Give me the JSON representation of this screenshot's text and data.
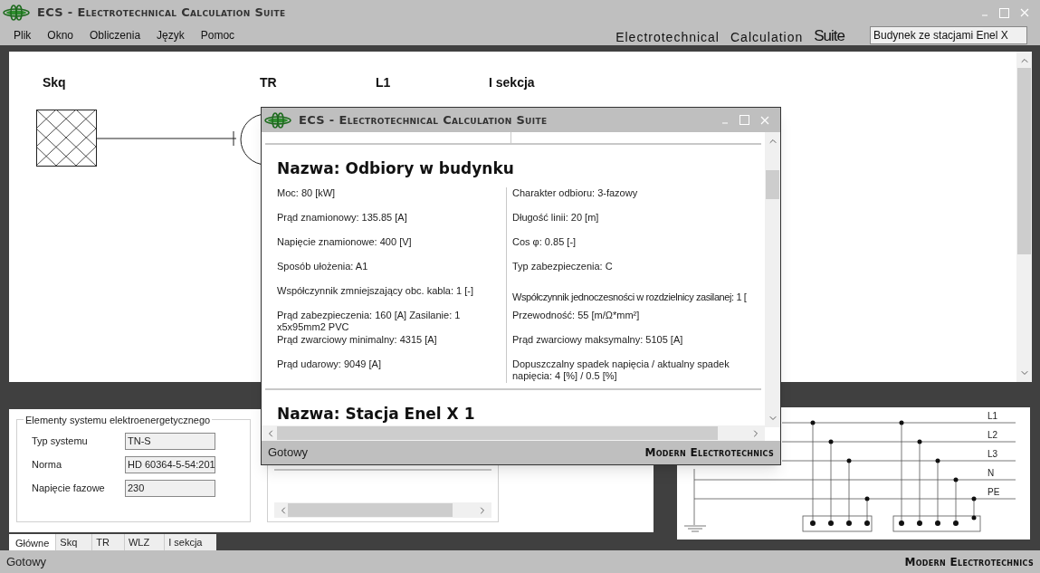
{
  "window": {
    "title": "ECS - Electrotechnical Calculation Suite"
  },
  "menu": [
    "Plik",
    "Okno",
    "Obliczenia",
    "Język",
    "Pomoc"
  ],
  "brand": {
    "words": [
      "Electrotechnical",
      "Calculation",
      "Suite"
    ]
  },
  "project_field": {
    "value": "Budynek ze stacjami Enel X"
  },
  "diagram": {
    "labels": [
      "Skq",
      "TR",
      "L1",
      "I sekcja"
    ]
  },
  "system_group": {
    "title": "Elementy systemu elektroenergetycznego",
    "fields": [
      {
        "label": "Typ systemu",
        "value": "TN-S"
      },
      {
        "label": "Norma",
        "value": "HD 60364-5-54:201"
      },
      {
        "label": "Napięcie fazowe",
        "value": "230"
      }
    ]
  },
  "tabs": [
    {
      "label": "Główne",
      "selected": true
    },
    {
      "label": "Skq",
      "selected": false
    },
    {
      "label": "TR",
      "selected": false
    },
    {
      "label": "WLZ",
      "selected": false
    },
    {
      "label": "I sekcja",
      "selected": false
    }
  ],
  "network_diagram": {
    "lines": [
      "L1",
      "L2",
      "L3",
      "N",
      "PE"
    ]
  },
  "status_bar": {
    "left": "Gotowy",
    "right": "Modern Electrotechnics"
  },
  "dialog": {
    "title": "ECS - Electrotechnical Calculation Suite",
    "sections": [
      {
        "name": "Nazwa: Odbiory w budynku",
        "left": [
          "Moc: 80 [kW]",
          "Prąd znamionowy: 135.85 [A]",
          "Napięcie znamionowe: 400 [V]",
          "Sposób ułożenia: A1",
          "Współczynnik zmniejszający obc. kabla: 1 [-]",
          "Prąd zabezpieczenia: 160 [A]   Zasilanie: 1 x5x95mm2  PVC",
          "Prąd zwarciowy minimalny: 4315 [A]",
          "Prąd udarowy: 9049 [A]"
        ],
        "right": [
          "Charakter odbioru: 3-fazowy",
          "Długość linii: 20 [m]",
          "Cos φ: 0.85 [-]",
          "Typ zabezpieczenia: C",
          "Współczynnik jednoczesności w rozdzielnicy zasilanej: 1 [",
          "Przewodność: 55 [m/Ω*mm²]",
          "Prąd zwarciowy maksymalny: 5105 [A]",
          "Dopuszczalny spadek napięcia / aktualny spadek napięcia: 4 [%] / 0.5 [%]"
        ]
      },
      {
        "name": "Nazwa: Stacja Enel X 1"
      }
    ],
    "status_bar": {
      "left": "Gotowy",
      "right": "Modern Electrotechnics"
    }
  }
}
